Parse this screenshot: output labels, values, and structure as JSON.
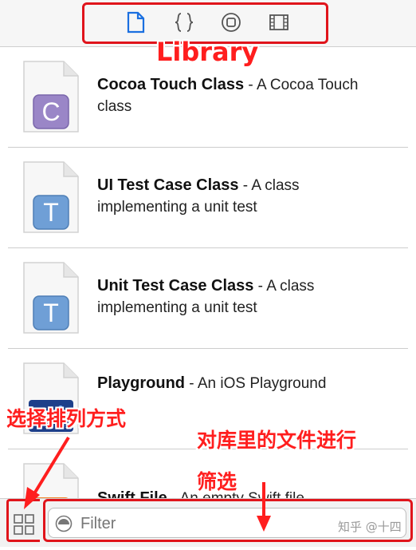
{
  "toolbar": {
    "tabs": [
      {
        "icon": "file-template-icon",
        "selected": true
      },
      {
        "icon": "code-snippet-icon",
        "selected": false
      },
      {
        "icon": "object-library-icon",
        "selected": false
      },
      {
        "icon": "media-library-icon",
        "selected": false
      }
    ],
    "accent_color": "#1a6fe0"
  },
  "annotations": {
    "library": "Library",
    "arrange": "选择排列方式",
    "filter_line1": "对库里的文件进行",
    "filter_line2": "筛选",
    "color": "#ff1e1e"
  },
  "templates": [
    {
      "name": "Cocoa Touch Class",
      "desc": " - A Cocoa Touch class",
      "letter": "C",
      "icon": "cocoa-touch-class-icon"
    },
    {
      "name": "UI Test Case Class",
      "desc": " - A class implementing a unit test",
      "letter": "T",
      "icon": "ui-test-case-icon"
    },
    {
      "name": "Unit Test Case Class",
      "desc": " - A class implementing a unit test",
      "letter": "T",
      "icon": "unit-test-case-icon"
    },
    {
      "name": "Playground",
      "desc": " - An iOS Playground",
      "letter": "",
      "icon": "playground-icon"
    },
    {
      "name": "Swift File",
      "desc": " - An empty Swift file",
      "letter": "",
      "icon": "swift-file-icon"
    }
  ],
  "filter": {
    "placeholder": "Filter"
  },
  "watermark": "知乎 @十四"
}
